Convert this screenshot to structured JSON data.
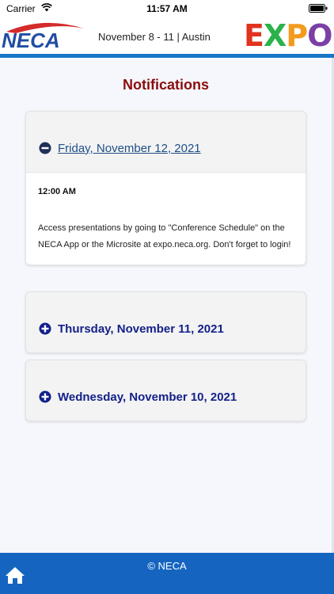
{
  "status_bar": {
    "carrier": "Carrier",
    "time": "11:57 AM"
  },
  "header": {
    "logo_text": "NECA",
    "event_info": "November 8 - 11 | Austin",
    "expo_letters": [
      "E",
      "X",
      "P",
      "O"
    ]
  },
  "page_title": "Notifications",
  "notifications": [
    {
      "date": " Friday, November 12, 2021",
      "expanded": true,
      "icon": "minus-circle-icon",
      "time": "12:00 AM",
      "message": "Access presentations by going to \"Conference Schedule\" on the NECA App or the Microsite at expo.neca.org. Don't forget to login!"
    },
    {
      "date": "Thursday, November 11, 2021",
      "expanded": false,
      "icon": "plus-circle-icon"
    },
    {
      "date": "Wednesday, November 10, 2021",
      "expanded": false,
      "icon": "plus-circle-icon"
    }
  ],
  "footer": {
    "copyright": "© NECA",
    "home_icon": "home-icon"
  },
  "colors": {
    "title": "#8b0d0d",
    "accent_blue": "#1565c0",
    "date_blue": "#14218a",
    "header_rule": "#1976c8"
  }
}
